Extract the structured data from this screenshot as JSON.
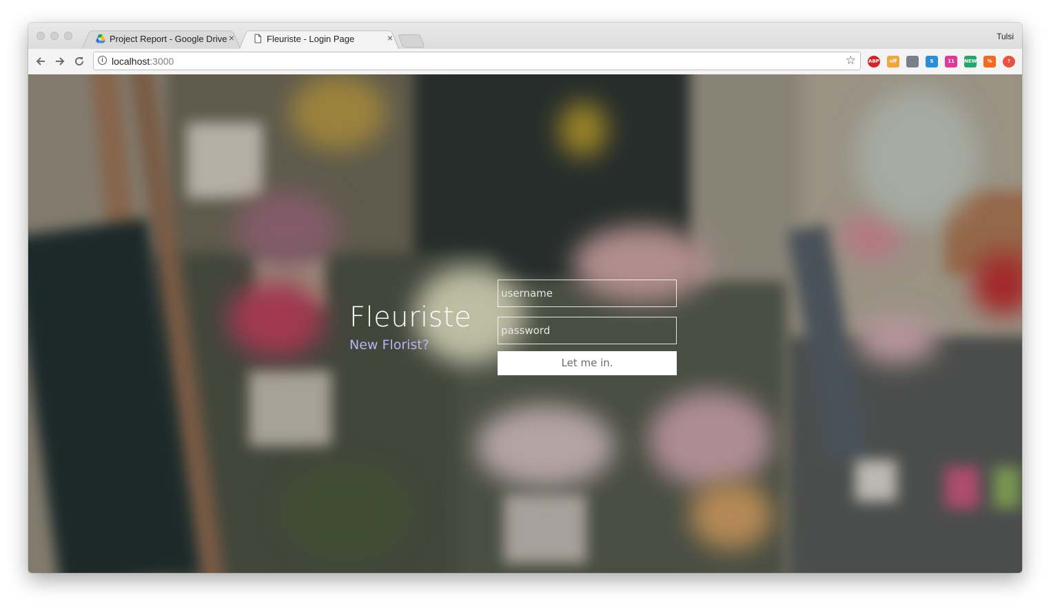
{
  "browser": {
    "tabs": [
      {
        "title": "Project Report - Google Drive",
        "icon": "google-drive-icon",
        "active": false
      },
      {
        "title": "Fleuriste - Login Page",
        "icon": "document-icon",
        "active": true
      }
    ],
    "tab_close_glyph": "×",
    "profile_name": "Tulsi",
    "url_host": "localhost",
    "url_port": ":3000",
    "extensions": [
      {
        "name": "adblock-plus-icon",
        "label": "ABP",
        "color": "#d92121"
      },
      {
        "name": "coupon-off-icon",
        "label": "off",
        "color": "#f3a53a"
      },
      {
        "name": "tool-extension-icon",
        "label": "",
        "color": "#7a7f8c"
      },
      {
        "name": "translate-s-icon",
        "label": "S",
        "color": "#2a8ed8"
      },
      {
        "name": "calendar-11-icon",
        "label": "11",
        "color": "#e0399a"
      },
      {
        "name": "new-badge-icon",
        "label": "NEW",
        "color": "#24a86a"
      },
      {
        "name": "percent-icon",
        "label": "%",
        "color": "#f26a21"
      },
      {
        "name": "upload-circle-icon",
        "label": "↑",
        "color": "#e8533f"
      }
    ]
  },
  "page": {
    "brand_title": "Fleuriste",
    "brand_link": "New Florist?",
    "username_placeholder": "username",
    "password_placeholder": "password",
    "submit_label": "Let me in.",
    "accent_color": "#b8b4f2"
  }
}
